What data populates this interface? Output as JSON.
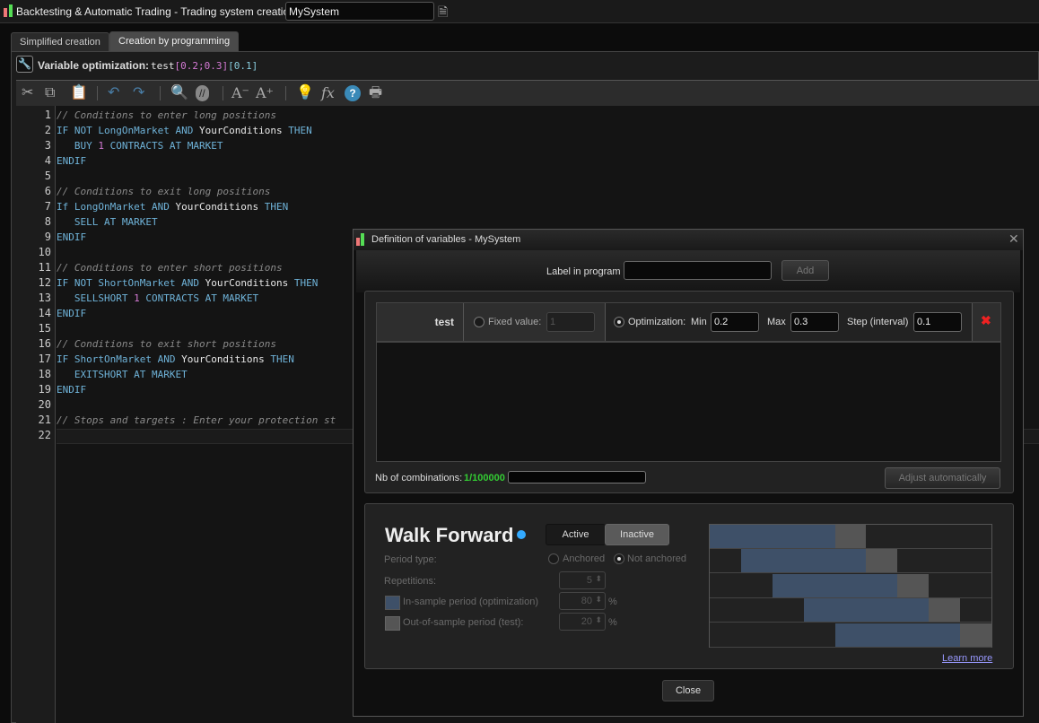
{
  "window": {
    "title": "Backtesting & Automatic Trading - Trading system creation  -",
    "system_name": "MySystem",
    "help_icon": "help-document-icon"
  },
  "tabs": [
    {
      "label": "Simplified creation",
      "active": false
    },
    {
      "label": "Creation by programming",
      "active": true
    }
  ],
  "variable_bar": {
    "label": "Variable optimization:",
    "name": "test",
    "range": "[0.2;0.3]",
    "step": "[0.1]"
  },
  "toolbar": [
    "cut-icon",
    "copy-icon",
    "paste-icon",
    "undo-icon",
    "redo-icon",
    "search-icon",
    "comment-icon",
    "font-decrease-icon",
    "font-increase-icon",
    "lightbulb-icon",
    "function-icon",
    "help-icon",
    "print-icon"
  ],
  "editor": {
    "lines": [
      [
        [
          "// Conditions to enter long positions",
          "cm"
        ]
      ],
      [
        [
          "IF NOT LongOnMarket AND ",
          "kw"
        ],
        [
          "YourConditions ",
          "tx"
        ],
        [
          "THEN",
          "kw"
        ]
      ],
      [
        [
          "   BUY ",
          "kw"
        ],
        [
          "1",
          "num"
        ],
        [
          " CONTRACTS AT MARKET",
          "kw"
        ]
      ],
      [
        [
          "ENDIF",
          "kw"
        ]
      ],
      [],
      [
        [
          "// Conditions to exit long positions",
          "cm"
        ]
      ],
      [
        [
          "If LongOnMarket AND ",
          "kw"
        ],
        [
          "YourConditions ",
          "tx"
        ],
        [
          "THEN",
          "kw"
        ]
      ],
      [
        [
          "   SELL AT MARKET",
          "kw"
        ]
      ],
      [
        [
          "ENDIF",
          "kw"
        ]
      ],
      [],
      [
        [
          "// Conditions to enter short positions",
          "cm"
        ]
      ],
      [
        [
          "IF NOT ShortOnMarket AND ",
          "kw"
        ],
        [
          "YourConditions ",
          "tx"
        ],
        [
          "THEN",
          "kw"
        ]
      ],
      [
        [
          "   SELLSHORT ",
          "kw"
        ],
        [
          "1",
          "num"
        ],
        [
          " CONTRACTS AT MARKET",
          "kw"
        ]
      ],
      [
        [
          "ENDIF",
          "kw"
        ]
      ],
      [],
      [
        [
          "// Conditions to exit short positions",
          "cm"
        ]
      ],
      [
        [
          "IF ShortOnMarket AND ",
          "kw"
        ],
        [
          "YourConditions ",
          "tx"
        ],
        [
          "THEN",
          "kw"
        ]
      ],
      [
        [
          "   EXITSHORT AT MARKET",
          "kw"
        ]
      ],
      [
        [
          "ENDIF",
          "kw"
        ]
      ],
      [],
      [
        [
          "// Stops and targets : Enter your protection st",
          "cm"
        ]
      ],
      []
    ]
  },
  "dialog": {
    "title": "Definition of variables - MySystem",
    "label_in_program": "Label in program",
    "label_value": "",
    "add": "Add",
    "variable": {
      "name": "test",
      "fixed_label": "Fixed value:",
      "fixed_value": "1",
      "opt_label": "Optimization:",
      "min_label": "Min",
      "min": "0.2",
      "max_label": "Max",
      "max": "0.3",
      "step_label": "Step (interval)",
      "step": "0.1",
      "mode": "optimization"
    },
    "combinations_label": "Nb of combinations:",
    "combinations": "1/100000",
    "combinations_progress": 1e-05,
    "adjust": "Adjust automatically",
    "walk_forward": {
      "title": "Walk Forward",
      "active": "Active",
      "inactive": "Inactive",
      "state": "Inactive",
      "period_type": "Period type:",
      "anchored": "Anchored",
      "not_anchored": "Not anchored",
      "selected_period": "Not anchored",
      "repetitions_label": "Repetitions:",
      "repetitions": "5",
      "in_sample_label": "In-sample period (optimization)",
      "in_sample": "80",
      "out_sample_label": "Out-of-sample period (test):",
      "out_sample": "20",
      "percent": "%",
      "learn_more": "Learn more",
      "colors": {
        "in_sample": "#3e5068",
        "out_sample": "#555555"
      }
    },
    "close": "Close"
  }
}
